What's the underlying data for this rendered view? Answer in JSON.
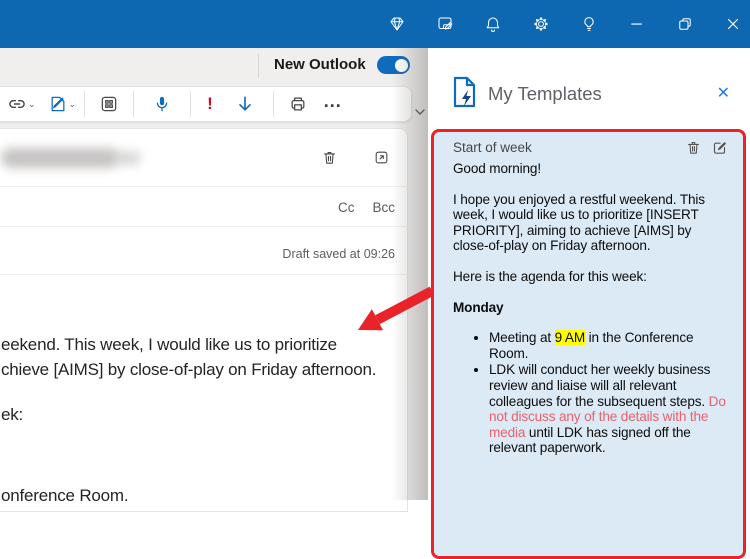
{
  "titlebar": {
    "icons": [
      {
        "name": "premium-gem-icon"
      },
      {
        "name": "feedback-note-icon"
      },
      {
        "name": "notifications-bell-icon"
      },
      {
        "name": "settings-gear-icon"
      },
      {
        "name": "tips-lightbulb-icon"
      },
      {
        "name": "minimize-icon"
      },
      {
        "name": "restore-icon"
      },
      {
        "name": "close-window-icon"
      }
    ]
  },
  "left": {
    "new_outlook": {
      "label": "New Outlook",
      "toggle_state": "on"
    },
    "toolbar": {
      "icons": [
        "link",
        "signature-pen",
        "apps-grid",
        "dictate-mic",
        "importance-high",
        "move-down",
        "print",
        "more-options"
      ],
      "importance_glyph": "!",
      "more_glyph": "..."
    },
    "compose": {
      "cc_label": "Cc",
      "bcc_label": "Bcc",
      "draft_status": "Draft saved at 09:26",
      "body_fragments": [
        "eekend. This week, I would like us to prioritize",
        "chieve [AIMS] by close-of-play on Friday afternoon.",
        "ek:",
        "onference Room."
      ]
    }
  },
  "panel": {
    "title": "My Templates",
    "close_glyph": "✕",
    "card": {
      "title": "Start of week",
      "greeting": "Good morning!",
      "paragraph": "I hope you enjoyed a restful weekend. This week, I would like us to prioritize [INSERT PRIORITY], aiming to achieve [AIMS] by close-of-play on Friday afternoon.",
      "agenda_intro": "Here is the agenda for this week:",
      "day_heading": "Monday",
      "bullets": [
        {
          "parts": [
            {
              "text": "Meeting at ",
              "style": "normal"
            },
            {
              "text": "9 AM",
              "style": "highlight"
            },
            {
              "text": " in the Conference Room.",
              "style": "normal"
            }
          ]
        },
        {
          "parts": [
            {
              "text": "LDK will conduct her weekly business review and liaise will all relevant colleagues for the subsequent steps. ",
              "style": "normal"
            },
            {
              "text": "Do not discuss any of the details with the media",
              "style": "red"
            },
            {
              "text": " until LDK has signed off the relevant paperwork.",
              "style": "normal"
            }
          ]
        }
      ]
    }
  },
  "colors": {
    "titlebar_blue": "#0d68b1",
    "accent_blue": "#0f6cbd",
    "template_card_bg": "#dceaf6",
    "annotation_red": "#e8232a",
    "warning_text_red": "#e8616c",
    "highlight_yellow": "#ffff00"
  }
}
